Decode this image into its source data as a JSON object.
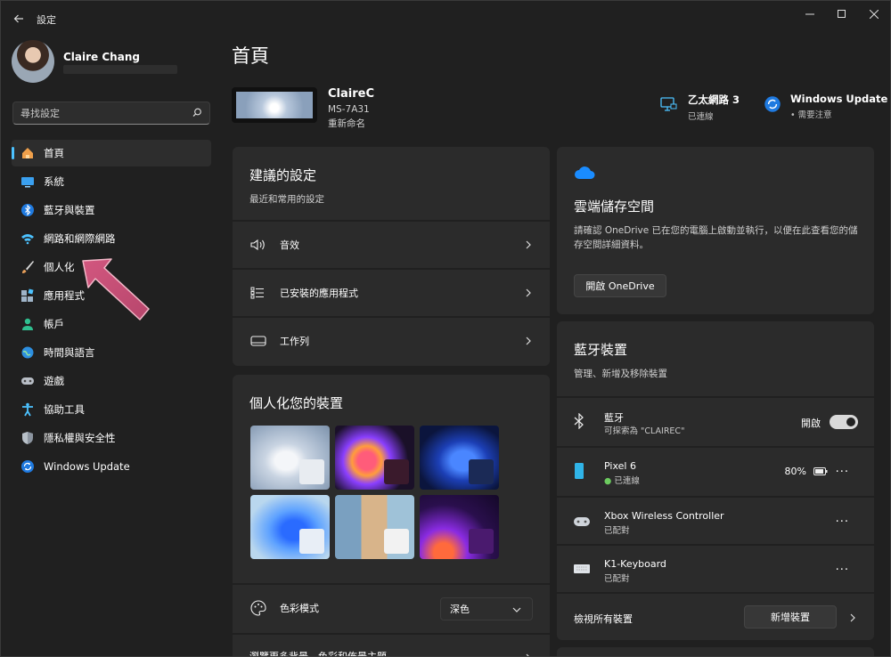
{
  "app": {
    "title": "設定"
  },
  "profile": {
    "name": "Claire Chang"
  },
  "search": {
    "placeholder": "尋找設定"
  },
  "nav": {
    "items": [
      {
        "label": "首頁",
        "active": true
      },
      {
        "label": "系統"
      },
      {
        "label": "藍牙與裝置"
      },
      {
        "label": "網路和網際網路"
      },
      {
        "label": "個人化"
      },
      {
        "label": "應用程式"
      },
      {
        "label": "帳戶"
      },
      {
        "label": "時間與語言"
      },
      {
        "label": "遊戲"
      },
      {
        "label": "協助工具"
      },
      {
        "label": "隱私權與安全性"
      },
      {
        "label": "Windows Update"
      }
    ]
  },
  "main": {
    "title": "首頁",
    "device": {
      "name": "ClaireC",
      "model": "MS-7A31",
      "rename": "重新命名"
    },
    "status": [
      {
        "title": "乙太網路 3",
        "sub": "已連線"
      },
      {
        "title": "Windows Update",
        "sub": "需要注意"
      }
    ]
  },
  "recommended": {
    "title": "建議的設定",
    "sub": "最近和常用的設定",
    "rows": [
      {
        "label": "音效",
        "icon": "speaker-icon"
      },
      {
        "label": "已安裝的應用程式",
        "icon": "apps-list-icon"
      },
      {
        "label": "工作列",
        "icon": "taskbar-icon"
      }
    ]
  },
  "personalize": {
    "title": "個人化您的裝置",
    "color_mode_label": "色彩模式",
    "color_mode_value": "深色",
    "more_text": "瀏覽更多背景、色彩和佈景主題"
  },
  "cloud": {
    "title": "雲端儲存空間",
    "desc": "請確認 OneDrive 已在您的電腦上啟動並執行，以便在此查看您的儲存空間詳細資料。",
    "button": "開啟 OneDrive"
  },
  "bluetooth": {
    "title": "藍牙裝置",
    "sub": "管理、新增及移除裝置",
    "bt_row": {
      "name": "藍牙",
      "sub": "可探索為 \"CLAIREC\"",
      "toggle_label": "開啟",
      "on": true
    },
    "devices": [
      {
        "name": "Pixel 6",
        "status": "已連線",
        "battery": "80%"
      },
      {
        "name": "Xbox Wireless Controller",
        "status": "已配對"
      },
      {
        "name": "K1-Keyboard",
        "status": "已配對"
      }
    ],
    "view_all": "檢視所有裝置",
    "add_button": "新增裝置"
  },
  "colors": {
    "accent": "#4cc2ff",
    "arrow": "#c8507a",
    "card": "#2b2b2b",
    "bg": "#202020"
  }
}
